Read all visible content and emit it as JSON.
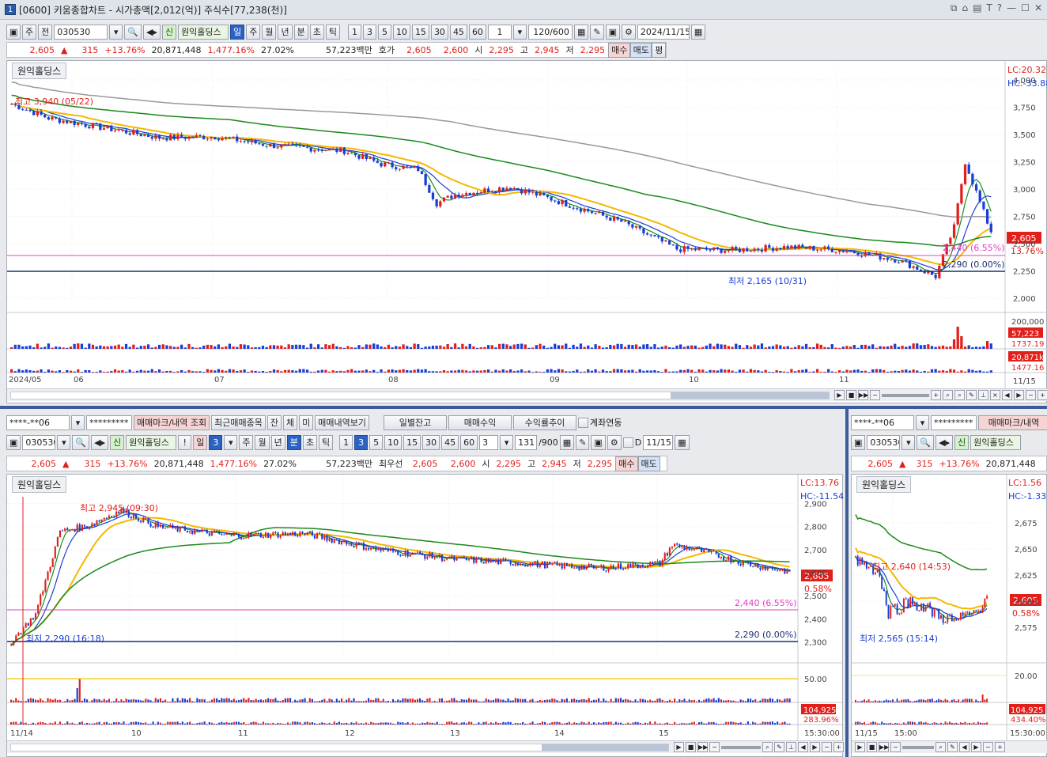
{
  "window": {
    "number": "1",
    "title": "[0600] 키움종합차트 - 시가총액[2,012(억)]  주식수[77,238(천)]",
    "icons": [
      "restore-icon",
      "pin-icon",
      "lock-icon",
      "font-icon",
      "help-icon",
      "minimize-icon",
      "maximize-icon",
      "close-icon"
    ]
  },
  "main": {
    "toolbar": {
      "period_btn": "주",
      "prev_btn": "전",
      "code": "030530",
      "credit_tag": "신",
      "stock_name": "원익홀딩스",
      "periods": [
        "일",
        "주",
        "월",
        "년",
        "분",
        "초",
        "틱"
      ],
      "nums": [
        "1",
        "3",
        "5",
        "10",
        "15",
        "30",
        "45",
        "60"
      ],
      "interval": "1",
      "count": "120/600",
      "date": "2024/11/15"
    },
    "quote": {
      "price": "2,605",
      "change": "315",
      "pct": "+13.76%",
      "volume": "20,871,448",
      "vol_pct": "1,477.16%",
      "turnover": "27.02%",
      "amount": "57,223백만",
      "quote_label": "호가",
      "ask": "2,605",
      "bid": "2,600",
      "open_l": "시",
      "open": "2,295",
      "high_l": "고",
      "high": "2,945",
      "low_l": "저",
      "low": "2,295",
      "buy": "매수",
      "sell": "매도",
      "avg": "평"
    },
    "chart_title": "원익홀딩스",
    "lc": "LC:20.32",
    "hc": "HC:-33.88",
    "annotations": {
      "high": "최고 3,940 (05/22)",
      "low": "최저 2,165 (10/31)",
      "line1": "2,440 (6.55%)",
      "line2": "2,290 (0.00%)",
      "price_tag": "2,605",
      "pct_tag": "13.76%"
    },
    "y_ticks": [
      "4,000",
      "3,750",
      "3,500",
      "3,250",
      "3,000",
      "2,750",
      "2,500",
      "2,250",
      "2,000"
    ],
    "vol_ticks": {
      "top": "200,000",
      "tag1": "57,223",
      "tag2": "1737.19",
      "tag3": "20,871k",
      "tag4": "1477.16"
    },
    "x_ticks": [
      "2024/05",
      "06",
      "07",
      "08",
      "09",
      "10",
      "11"
    ],
    "x_right": "11/15"
  },
  "bottom_left": {
    "row1": {
      "account": "****-**06",
      "pw": "*********",
      "b1": "매매마크/내역 조회",
      "b2": "최근매매종목",
      "b3": "잔",
      "b4": "체",
      "b5": "미",
      "b6": "매매내역보기",
      "b7": "일별잔고",
      "b8": "매매수익",
      "b9": "수익률추이",
      "chk": "계좌연동"
    },
    "toolbar": {
      "code": "030530",
      "credit_tag": "신",
      "stock_name": "원익홀딩스",
      "excl": "!",
      "period": "일",
      "val": "3",
      "periods": [
        "주",
        "월",
        "년",
        "분",
        "초",
        "틱"
      ],
      "nums": [
        "1",
        "3",
        "5",
        "10",
        "15",
        "30",
        "45",
        "60"
      ],
      "interval": "3",
      "count": "131",
      "total": "/900",
      "d": "D",
      "date": "11/15"
    },
    "quote": {
      "price": "2,605",
      "change": "315",
      "pct": "+13.76%",
      "volume": "20,871,448",
      "vol_pct": "1,477.16%",
      "turnover": "27.02%",
      "amount": "57,223백만",
      "quote_label": "최우선",
      "ask": "2,605",
      "bid": "2,600",
      "open_l": "시",
      "open": "2,295",
      "high_l": "고",
      "high": "2,945",
      "low_l": "저",
      "low": "2,295",
      "buy": "매수",
      "sell": "매도"
    },
    "chart_title": "원익홀딩스",
    "lc": "LC:13.76",
    "hc": "HC:-11.54",
    "annotations": {
      "high": "최고 2,945 (09:30)",
      "low": "최저 2,290 (16:18)",
      "line1": "2,440 (6.55%)",
      "line2": "2,290 (0.00%)",
      "price_tag": "2,605",
      "pct_tag": "0.58%"
    },
    "y_ticks": [
      "2,900",
      "2,800",
      "2,700",
      "2,600",
      "2,500",
      "2,400",
      "2,300"
    ],
    "vol_ticks": {
      "t1": "50.00",
      "tag1": "104,925",
      "tag2": "283.96%"
    },
    "x_ticks": [
      "11/14",
      "10",
      "11",
      "12",
      "13",
      "14",
      "15"
    ],
    "x_right": "15:30:00"
  },
  "bottom_right": {
    "row1": {
      "account": "****-**06",
      "pw": "*********",
      "b1": "매매마크/내역"
    },
    "toolbar": {
      "code": "030530",
      "credit_tag": "신",
      "stock_name": "원익홀딩스"
    },
    "quote": {
      "price": "2,605",
      "change": "315",
      "pct": "+13.76%",
      "volume": "20,871,448"
    },
    "chart_title": "원익홀딩스",
    "lc": "LC:1.56",
    "hc": "HC:-1.33",
    "annotations": {
      "high": "최고 2,640 (14:53)",
      "low": "최저 2,565 (15:14)",
      "price_tag": "2,605",
      "pct_tag": "0.58%"
    },
    "y_ticks": [
      "2,675",
      "2,650",
      "2,625",
      "2,600",
      "2,575"
    ],
    "vol_ticks": {
      "t1": "20.00",
      "tag1": "104,925",
      "tag2": "434.40%"
    },
    "x_ticks": [
      "11/15",
      "15:00"
    ],
    "x_right": "15:30:00"
  },
  "chart_data": [
    {
      "type": "candlestick",
      "name": "원익홀딩스 주봉/일봉",
      "x_range": [
        "2024/05",
        "2024/11/15"
      ],
      "ylim": [
        2000,
        4000
      ],
      "high": 3940,
      "high_date": "05/22",
      "low": 2165,
      "low_date": "10/31",
      "last": 2605,
      "hlines": [
        2440,
        2290
      ]
    },
    {
      "type": "candlestick",
      "name": "원익홀딩스 3분",
      "x_range": [
        "11/14",
        "11/15 15:30"
      ],
      "ylim": [
        2250,
        2950
      ],
      "high": 2945,
      "low": 2290,
      "last": 2605,
      "hlines": [
        2440,
        2290
      ]
    },
    {
      "type": "candlestick",
      "name": "원익홀딩스 분",
      "x_range": [
        "11/15",
        "15:30"
      ],
      "ylim": [
        2550,
        2700
      ],
      "high": 2640,
      "low": 2565,
      "last": 2605
    }
  ]
}
